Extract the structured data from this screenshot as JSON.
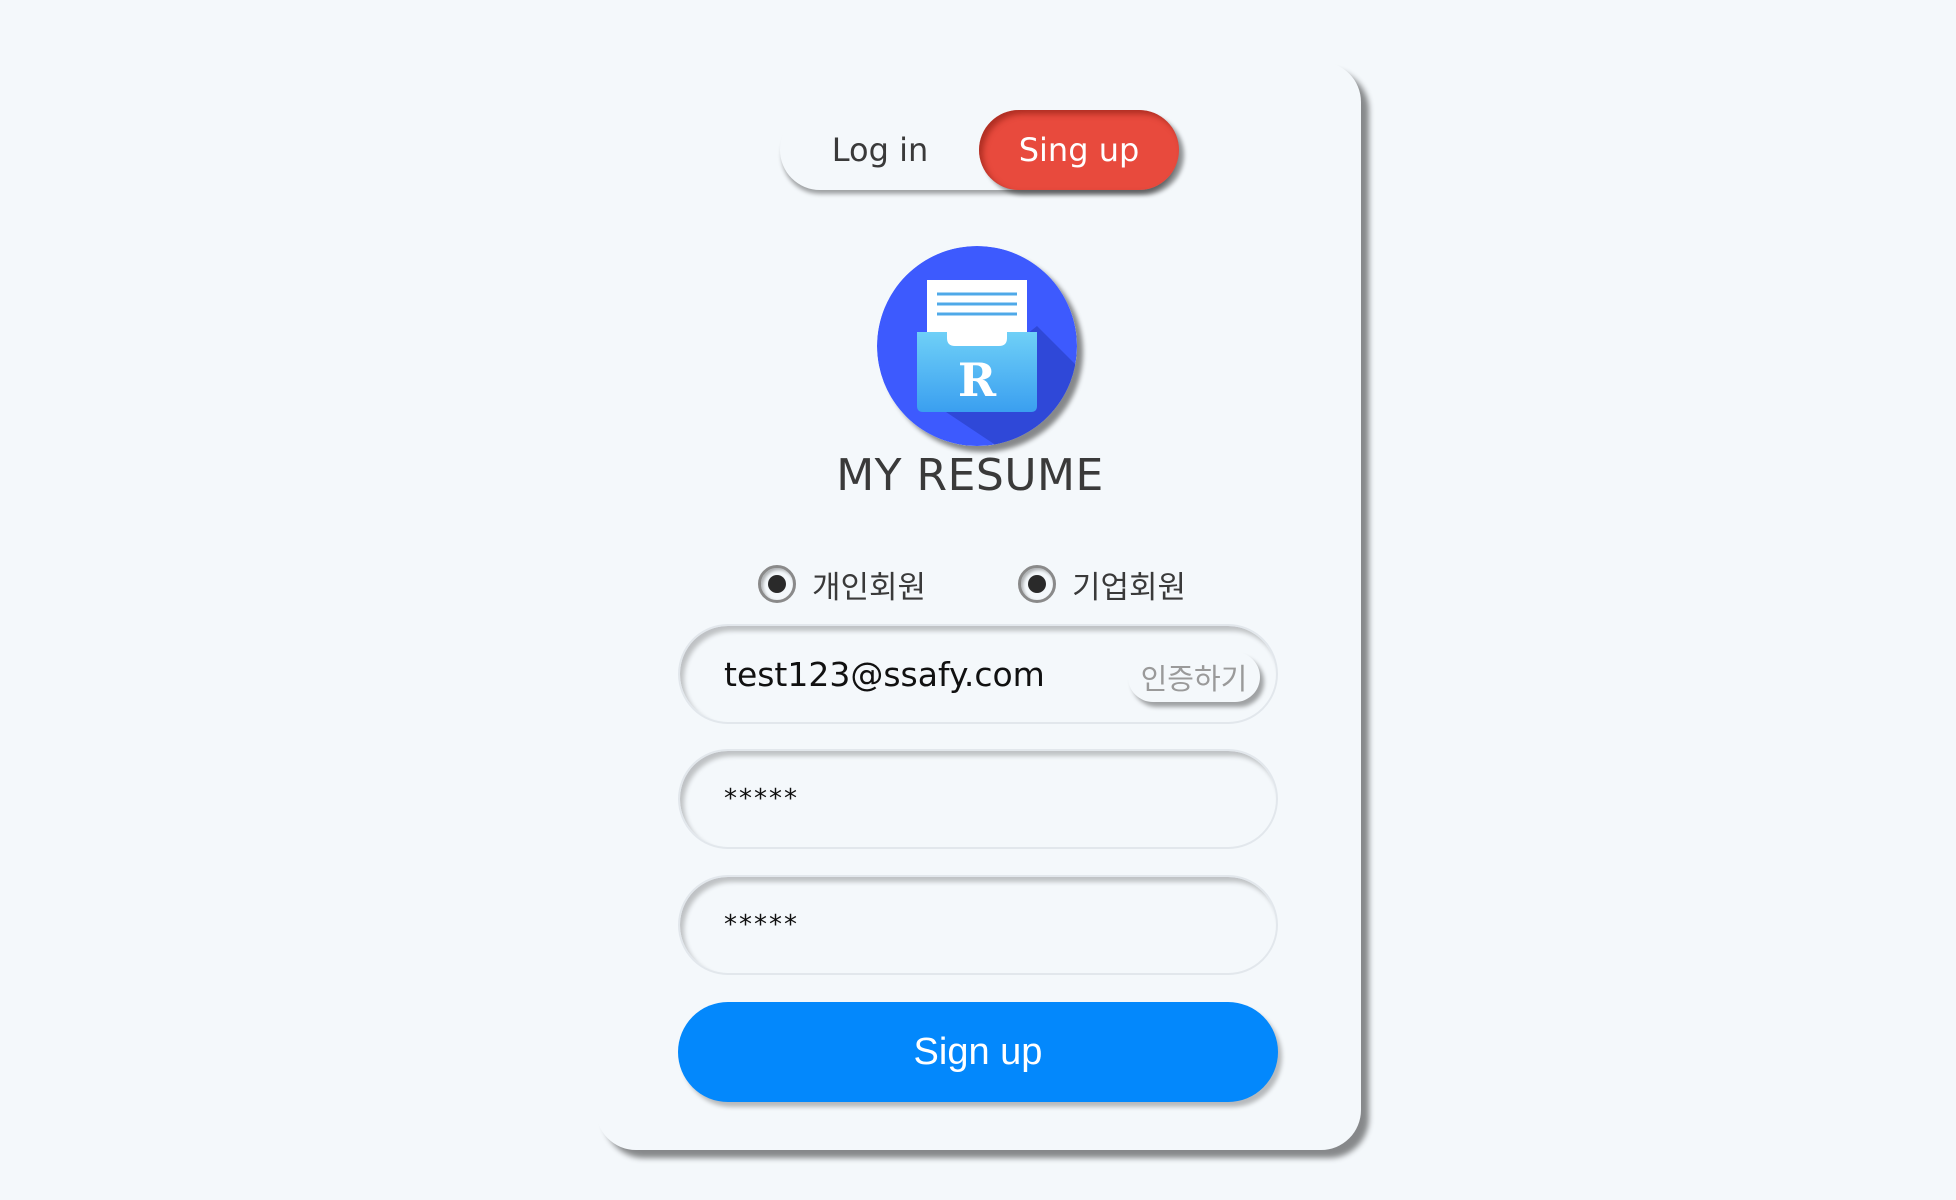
{
  "toggle": {
    "login_label": "Log in",
    "signup_label": "Sing up",
    "active": "signup"
  },
  "brand": {
    "logo_letter": "R",
    "title": "MY RESUME"
  },
  "member_type": {
    "options": [
      {
        "label": "개인회원",
        "selected": true
      },
      {
        "label": "기업회원",
        "selected": true
      }
    ]
  },
  "form": {
    "email_value": "test123@ssafy.com",
    "verify_label": "인증하기",
    "password_value": "*****",
    "password_confirm_value": "*****",
    "submit_label": "Sign up"
  },
  "colors": {
    "accent_signup_toggle": "#e84a3d",
    "primary_button": "#0388fc",
    "logo_circle": "#3d5afe",
    "background": "#f4f8fb"
  }
}
